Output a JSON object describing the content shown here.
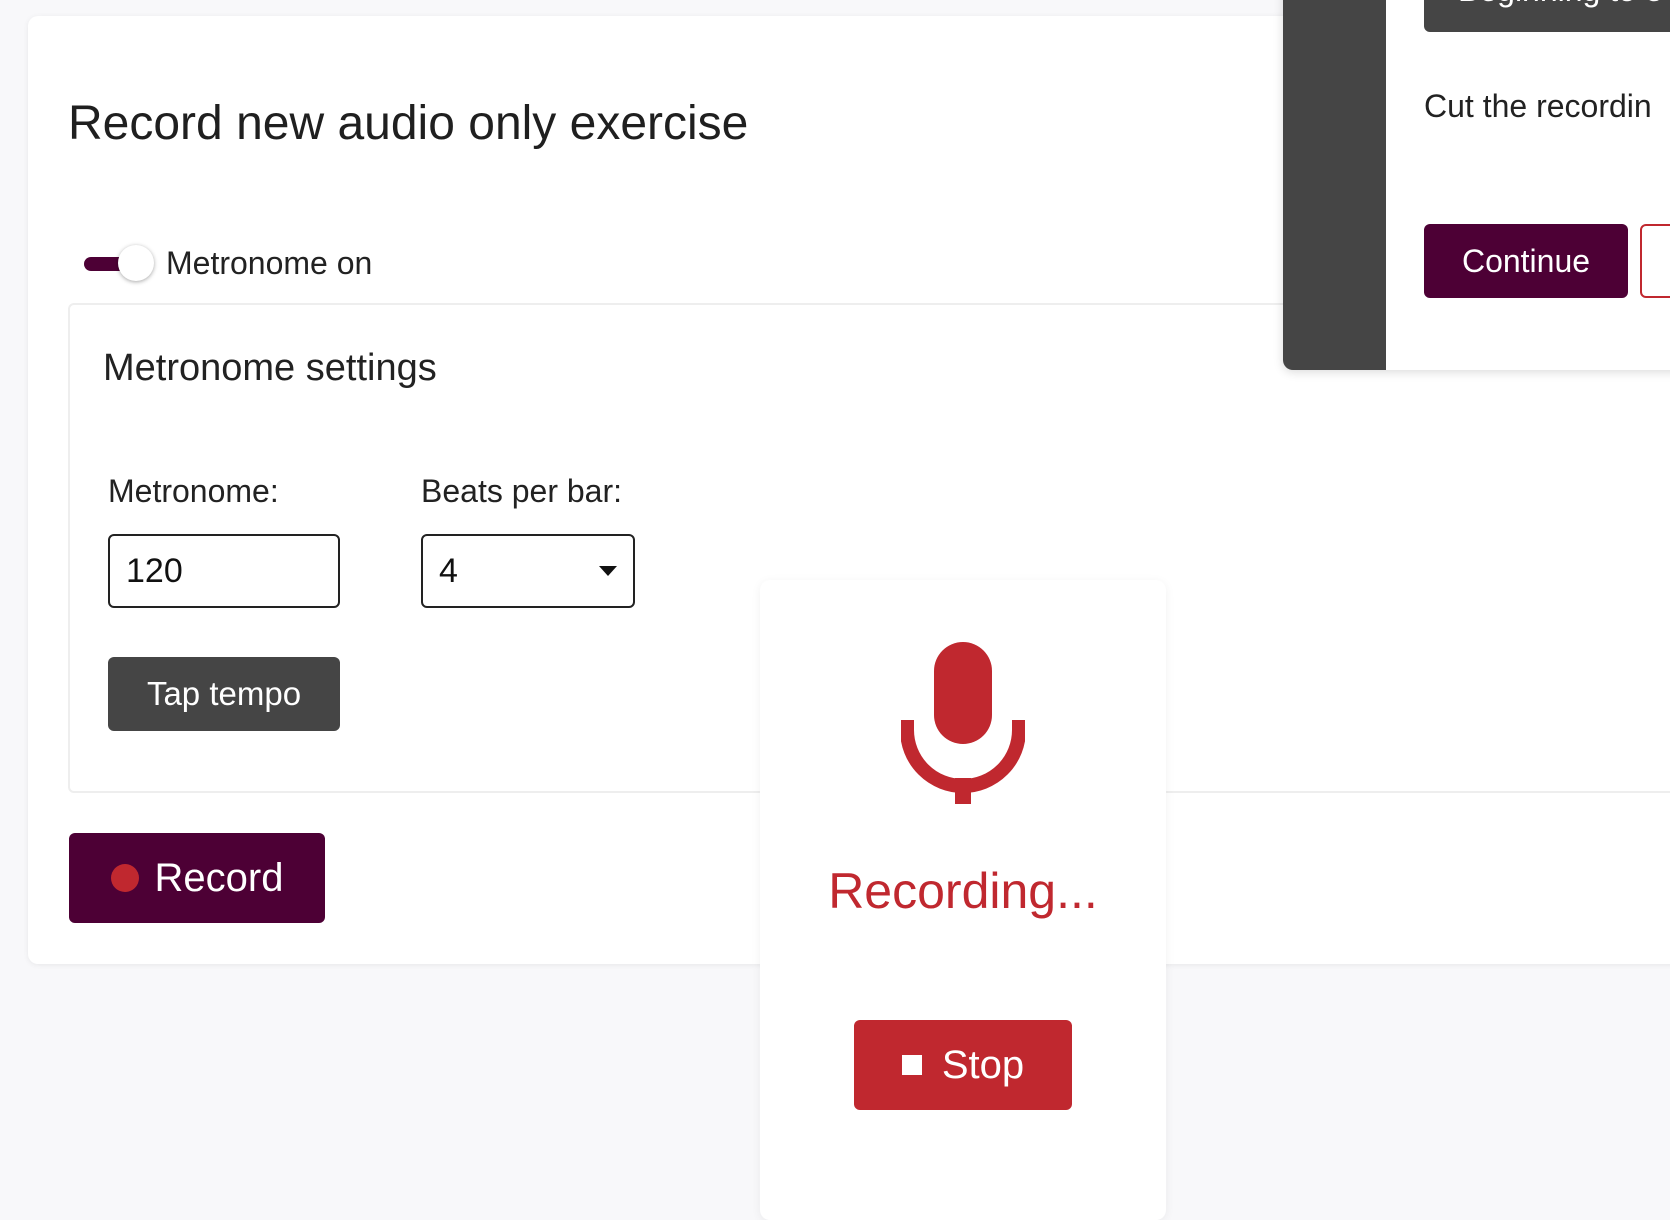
{
  "page": {
    "title": "Record new audio only exercise"
  },
  "metronome_toggle": {
    "label": "Metronome on",
    "state": "on"
  },
  "metronome_settings": {
    "title": "Metronome settings",
    "bpm_label": "Metronome:",
    "bpm_value": "120",
    "beats_label": "Beats per bar:",
    "beats_value": "4",
    "tap_tempo_label": "Tap tempo"
  },
  "record_button": {
    "label": "Record"
  },
  "recording_panel": {
    "status": "Recording...",
    "stop_label": "Stop"
  },
  "dialog": {
    "option_label": "Beginning to e",
    "message": "Cut the recordin",
    "continue_label": "Continue"
  },
  "icons": {
    "microphone": "microphone-icon",
    "record_dot": "record-dot-icon",
    "stop_square": "stop-square-icon",
    "caret": "chevron-down-icon"
  },
  "colors": {
    "brand": "#4d0035",
    "recording_red": "#c0282f",
    "dark_button": "#454545",
    "background": "#f8f8fa"
  }
}
